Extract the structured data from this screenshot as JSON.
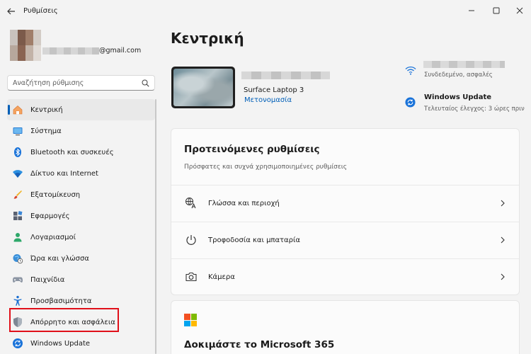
{
  "window": {
    "title": "Ρυθμίσεις"
  },
  "profile": {
    "email_suffix": "@gmail.com"
  },
  "search": {
    "placeholder": "Αναζήτηση ρύθμισης"
  },
  "sidebar": {
    "items": [
      {
        "label": "Κεντρική",
        "icon": "home-icon",
        "active": true
      },
      {
        "label": "Σύστημα",
        "icon": "system-icon"
      },
      {
        "label": "Bluetooth και συσκευές",
        "icon": "bluetooth-icon"
      },
      {
        "label": "Δίκτυο και Internet",
        "icon": "network-icon"
      },
      {
        "label": "Εξατομίκευση",
        "icon": "personalization-icon"
      },
      {
        "label": "Εφαρμογές",
        "icon": "apps-icon"
      },
      {
        "label": "Λογαριασμοί",
        "icon": "accounts-icon"
      },
      {
        "label": "Ώρα και γλώσσα",
        "icon": "time-language-icon"
      },
      {
        "label": "Παιχνίδια",
        "icon": "gaming-icon"
      },
      {
        "label": "Προσβασιμότητα",
        "icon": "accessibility-icon"
      },
      {
        "label": "Απόρρητο και ασφάλεια",
        "icon": "privacy-shield-icon",
        "highlighted": true
      },
      {
        "label": "Windows Update",
        "icon": "windows-update-icon"
      }
    ]
  },
  "main": {
    "title": "Κεντρική",
    "device": {
      "model": "Surface Laptop 3",
      "rename_label": "Μετονομασία"
    },
    "wifi": {
      "status": "Συνδεδεμένο, ασφαλές"
    },
    "windows_update": {
      "title": "Windows Update",
      "status": "Τελευταίος έλεγχος: 3 ώρες πριν"
    },
    "recommended": {
      "title": "Προτεινόμενες ρυθμίσεις",
      "subtitle": "Πρόσφατες και συχνά χρησιμοποιημένες ρυθμίσεις",
      "rows": [
        {
          "label": "Γλώσσα και περιοχή",
          "icon": "language-icon"
        },
        {
          "label": "Τροφοδοσία και μπαταρία",
          "icon": "power-icon"
        },
        {
          "label": "Κάμερα",
          "icon": "camera-icon"
        }
      ]
    },
    "m365": {
      "title": "Δοκιμάστε το Microsoft 365"
    }
  },
  "colors": {
    "accent": "#005fb8",
    "highlight_border": "#e0101a",
    "background": "#f3f3f3"
  }
}
